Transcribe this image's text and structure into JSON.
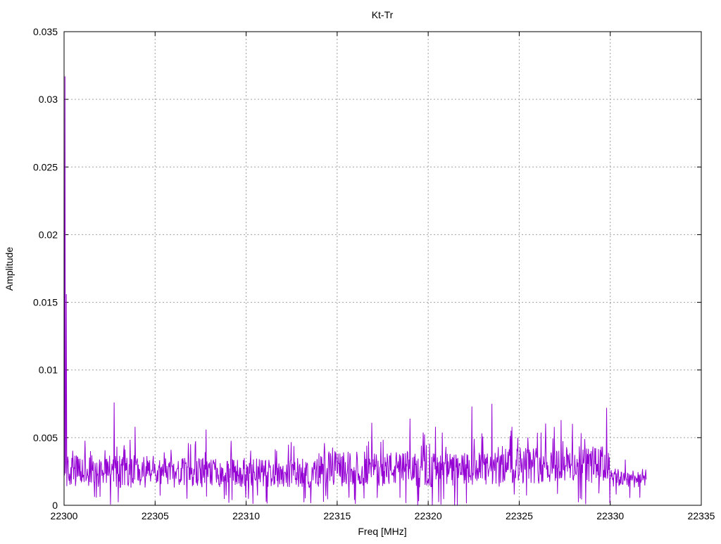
{
  "chart_data": {
    "type": "line",
    "title": "Kt-Tr",
    "xlabel": "Freq [MHz]",
    "ylabel": "Amplitude",
    "xlim": [
      22300,
      22335
    ],
    "ylim": [
      0,
      0.035
    ],
    "xticks": [
      "22300",
      "22305",
      "22310",
      "22315",
      "22320",
      "22325",
      "22330",
      "22335"
    ],
    "yticks": [
      "0",
      "0.005",
      "0.01",
      "0.015",
      "0.02",
      "0.025",
      "0.03",
      "0.035"
    ],
    "grid": true,
    "legend": "none",
    "series": [
      {
        "color": "#9400d3",
        "x_start": 22300,
        "x_end": 22332,
        "peaks": [
          {
            "x": 22300.05,
            "y": 0.0317
          },
          {
            "x": 22300.12,
            "y": 0.0156
          },
          {
            "x": 22302.75,
            "y": 0.0076
          },
          {
            "x": 22303.9,
            "y": 0.0058
          },
          {
            "x": 22307.8,
            "y": 0.0056
          },
          {
            "x": 22316.9,
            "y": 0.0061
          },
          {
            "x": 22319.0,
            "y": 0.0064
          },
          {
            "x": 22320.4,
            "y": 0.0058
          },
          {
            "x": 22322.4,
            "y": 0.0073
          },
          {
            "x": 22323.5,
            "y": 0.0075
          },
          {
            "x": 22324.6,
            "y": 0.0058
          },
          {
            "x": 22327.3,
            "y": 0.0063
          },
          {
            "x": 22329.8,
            "y": 0.0072
          }
        ],
        "segments": [
          {
            "x0": 22300,
            "x1": 22305,
            "mean": 0.0025,
            "spread": 0.0012
          },
          {
            "x0": 22305,
            "x1": 22314,
            "mean": 0.0024,
            "spread": 0.0011
          },
          {
            "x0": 22314,
            "x1": 22319,
            "mean": 0.0027,
            "spread": 0.0013
          },
          {
            "x0": 22319,
            "x1": 22324,
            "mean": 0.0026,
            "spread": 0.0013
          },
          {
            "x0": 22324,
            "x1": 22330,
            "mean": 0.003,
            "spread": 0.0014
          },
          {
            "x0": 22330,
            "x1": 22332,
            "mean": 0.002,
            "spread": 0.0007
          }
        ]
      }
    ]
  }
}
